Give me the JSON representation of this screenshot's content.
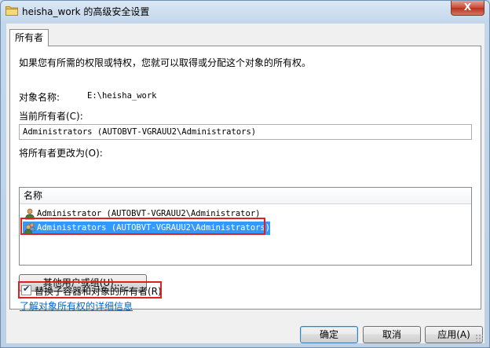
{
  "window": {
    "title": "heisha_work 的高级安全设置",
    "close_label": "X"
  },
  "tabs": [
    {
      "label": "所有者"
    }
  ],
  "owner_page": {
    "description": "如果您有所需的权限或特权，您就可以取得或分配这个对象的所有权。",
    "object_name_label": "对象名称:",
    "object_name_value": "E:\\heisha_work",
    "current_owner_label": "当前所有者(C):",
    "current_owner_value": "Administrators (AUTOBVT-VGRAUU2\\Administrators)",
    "change_owner_label": "将所有者更改为(O):",
    "list_header": "名称",
    "list_items": [
      {
        "label": "Administrator (AUTOBVT-VGRAUU2\\Administrator)",
        "icon": "user-icon",
        "selected": false
      },
      {
        "label": "Administrators (AUTOBVT-VGRAUU2\\Administrators)",
        "icon": "user-group-icon",
        "selected": true
      }
    ],
    "other_users_button": "其他用户或组(U)...",
    "replace_owner_checkbox_label": "替换子容器和对象的所有者(R)",
    "replace_owner_checked": true,
    "learn_more_link": "了解对象所有权的详细信息"
  },
  "buttons": {
    "ok": "确定",
    "cancel": "取消",
    "apply": "应用(A)"
  },
  "colors": {
    "selection": "#3399ff",
    "highlight_box": "#e02020",
    "link": "#0066cc"
  }
}
